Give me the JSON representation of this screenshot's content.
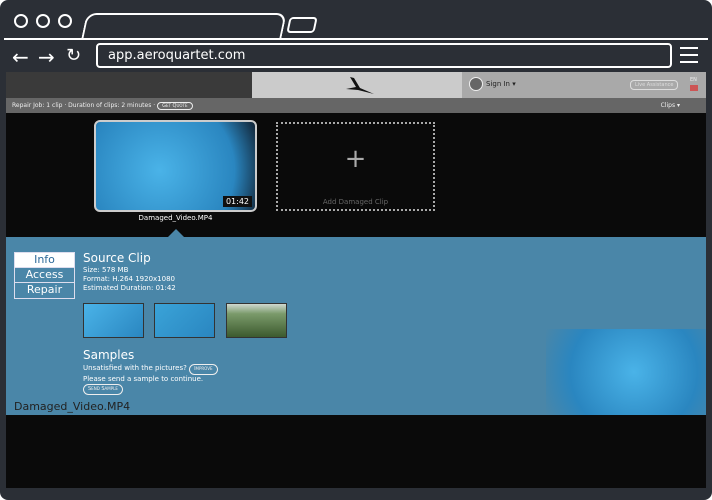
{
  "browser": {
    "url": "app.aeroquartet.com"
  },
  "header": {
    "sign_in": "Sign In ▾",
    "live_assistance": "Live Assistance",
    "lang": "EN"
  },
  "subbar": {
    "job_text": "Repair Job: 1 clip · Duration of clips: 2 minutes ·",
    "get_quote": "Get Quote",
    "clips_menu": "Clips ▾"
  },
  "clip": {
    "name": "Damaged_Video.MP4",
    "duration": "01:42"
  },
  "add_clip": {
    "plus": "+",
    "label": "Add Damaged Clip"
  },
  "panel": {
    "tabs": [
      {
        "label": "Info",
        "active": true
      },
      {
        "label": "Access",
        "active": false
      },
      {
        "label": "Repair",
        "active": false
      }
    ],
    "source_title": "Source Clip",
    "size": "Size: 578 MB",
    "format": "Format: H.264 1920x1080",
    "estimated": "Estimated Duration: 01:42",
    "samples_title": "Samples",
    "unsatisfied": "Unsatisfied with the pictures?",
    "improve": "Improve",
    "please": "Please send a sample to continue.",
    "send_sample": "Send Sample",
    "filename": "Damaged_Video.MP4"
  },
  "colors": {
    "panel": "#4a86a8",
    "active_tab_text": "#2d6a9a"
  }
}
